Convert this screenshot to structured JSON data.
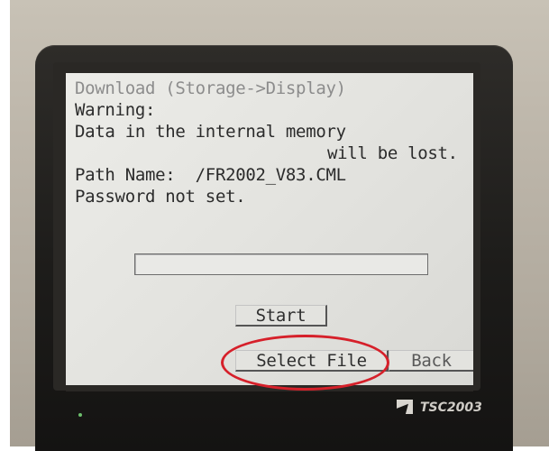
{
  "screen": {
    "title": "Download (Storage->Display)",
    "warning_label": "Warning:",
    "warning_line1": "Data in the internal memory",
    "warning_line2": "will be lost.",
    "path_label": "Path Name:  /FR2002_V83.CML",
    "password_status": "Password not set.",
    "progress": 0
  },
  "buttons": {
    "start": "Start",
    "select_file": "Select File",
    "back": "Back"
  },
  "device": {
    "model": "TSC2003"
  },
  "colors": {
    "annotation": "#d6202a",
    "screen_bg": "#e4e4e0"
  }
}
